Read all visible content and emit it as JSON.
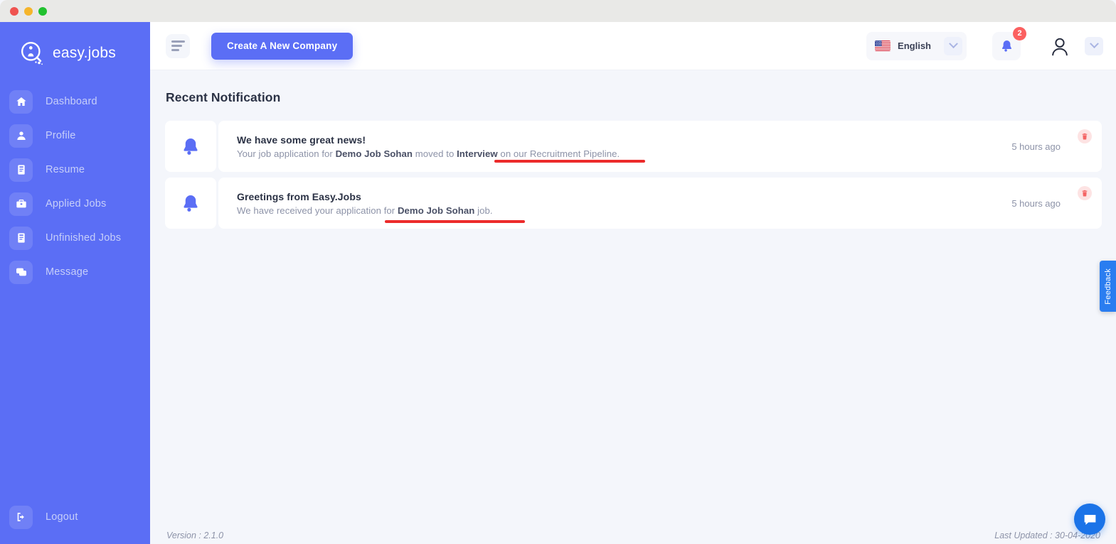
{
  "window": {
    "traffic_lights": [
      "close",
      "minimize",
      "maximize"
    ]
  },
  "sidebar": {
    "brand": "easy.jobs",
    "items": [
      {
        "label": "Dashboard",
        "icon": "home-icon"
      },
      {
        "label": "Profile",
        "icon": "user-icon"
      },
      {
        "label": "Resume",
        "icon": "resume-icon"
      },
      {
        "label": "Applied Jobs",
        "icon": "briefcase-icon"
      },
      {
        "label": "Unfinished Jobs",
        "icon": "document-icon"
      },
      {
        "label": "Message",
        "icon": "chat-icon"
      }
    ],
    "logout": {
      "label": "Logout",
      "icon": "logout-icon"
    }
  },
  "header": {
    "menu_toggle": "hamburger-icon",
    "create_company_label": "Create A New Company",
    "language": {
      "label": "English",
      "flag": "us-flag-icon"
    },
    "notifications": {
      "icon": "bell-icon",
      "count": "2"
    },
    "account": {
      "icon": "user-avatar-icon"
    }
  },
  "main": {
    "page_title": "Recent Notification",
    "notifications": [
      {
        "icon": "bell-icon",
        "title": "We have some great news!",
        "desc_parts": [
          {
            "text": "Your job application for ",
            "bold": false
          },
          {
            "text": "Demo Job Sohan",
            "bold": true
          },
          {
            "text": " moved to ",
            "bold": false
          },
          {
            "text": "Interview",
            "bold": true
          },
          {
            "text": " on our Recruitment Pipeline.",
            "bold": false
          }
        ],
        "time": "5 hours ago",
        "delete_icon": "trash-icon"
      },
      {
        "icon": "bell-icon",
        "title": "Greetings from Easy.Jobs",
        "desc_parts": [
          {
            "text": "We have received your application for ",
            "bold": false
          },
          {
            "text": "Demo Job Sohan",
            "bold": true
          },
          {
            "text": " job.",
            "bold": false
          }
        ],
        "time": "5 hours ago",
        "delete_icon": "trash-icon"
      }
    ]
  },
  "footer": {
    "version": "Version : 2.1.0",
    "last_updated": "Last Updated : 30-04-2020"
  },
  "feedback_tab": {
    "label": "Feedback"
  },
  "chat_widget": {
    "icon": "chat-bubble-icon"
  },
  "colors": {
    "brand": "#5b6ef5",
    "page_bg": "#f4f6fb",
    "card": "#ffffff",
    "badge": "#fb6060",
    "annotation": "#ec2b2b",
    "feedback": "#2a7df0",
    "chat": "#1a73e8"
  }
}
